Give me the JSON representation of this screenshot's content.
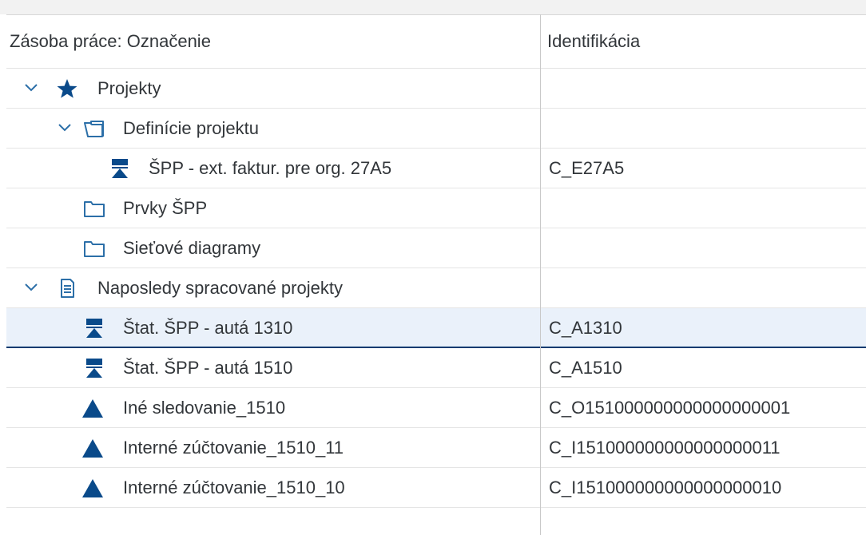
{
  "columns": {
    "label": "Zásoba práce: Označenie",
    "id": "Identifikácia"
  },
  "rows": [
    {
      "label": "Projekty",
      "id": "",
      "icon": "star-icon",
      "expanded": true
    },
    {
      "label": "Definície projektu",
      "id": "",
      "icon": "open-folder-icon",
      "expanded": true
    },
    {
      "label": "ŠPP - ext. faktur. pre org. 27A5",
      "id": "C_E27A5",
      "icon": "wbs-element-icon"
    },
    {
      "label": "Prvky ŠPP",
      "id": "",
      "icon": "folder-icon"
    },
    {
      "label": "Sieťové diagramy",
      "id": "",
      "icon": "folder-icon"
    },
    {
      "label": "Naposledy spracované projekty",
      "id": "",
      "icon": "document-icon",
      "expanded": true
    },
    {
      "label": "Štat. ŠPP - autá 1310",
      "id": "C_A1310",
      "icon": "wbs-element-icon",
      "selected": true
    },
    {
      "label": "Štat. ŠPP - autá 1510",
      "id": "C_A1510",
      "icon": "wbs-element-icon"
    },
    {
      "label": "Iné sledovanie_1510",
      "id": "C_O151000000000000000001",
      "icon": "triangle-icon"
    },
    {
      "label": "Interné zúčtovanie_1510_11",
      "id": "C_I151000000000000000011",
      "icon": "triangle-icon"
    },
    {
      "label": "Interné zúčtovanie_1510_10",
      "id": "C_I151000000000000000010",
      "icon": "triangle-icon"
    }
  ],
  "colors": {
    "icon": "#0a4a8a",
    "outline": "#2c6fa8",
    "selected_bg": "#eaf1fa",
    "selected_border": "#0a3b6f"
  }
}
